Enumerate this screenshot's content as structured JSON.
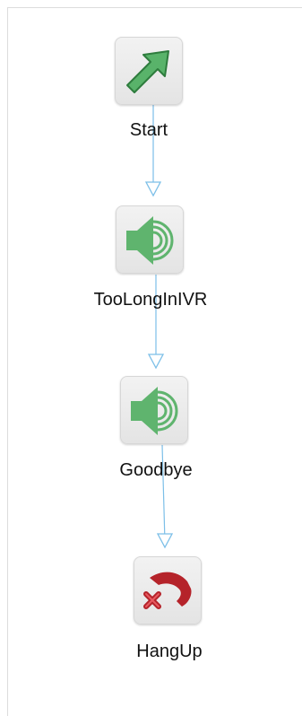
{
  "flow": {
    "nodes": [
      {
        "id": "start",
        "label": "Start",
        "icon": "arrow-up-right-icon"
      },
      {
        "id": "toolong",
        "label": "TooLongInIVR",
        "icon": "speaker-icon"
      },
      {
        "id": "goodbye",
        "label": "Goodbye",
        "icon": "speaker-icon"
      },
      {
        "id": "hangup",
        "label": "HangUp",
        "icon": "hangup-phone-icon"
      }
    ]
  },
  "colors": {
    "arrow_green": "#59b36a",
    "speaker_green": "#5fb46e",
    "hangup_red": "#b5232a",
    "connector_blue": "#7cbfe8"
  }
}
